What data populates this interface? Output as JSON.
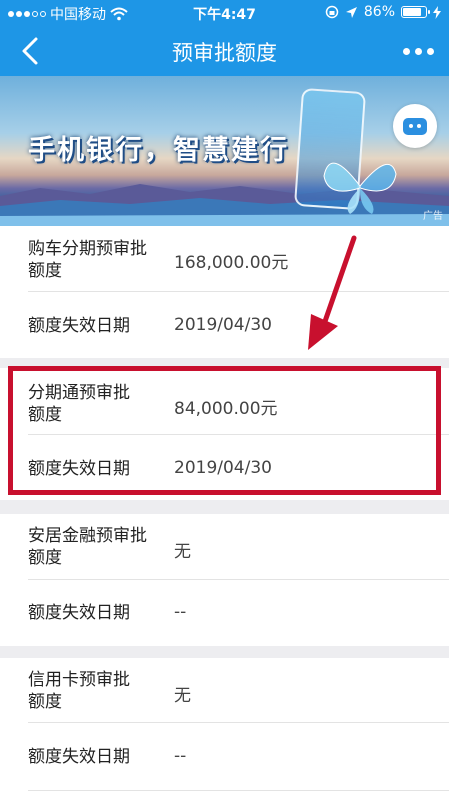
{
  "status_bar": {
    "carrier": "中国移动",
    "time": "下午4:47",
    "battery": "86%",
    "battery_level": 0.86
  },
  "nav": {
    "title": "预审批额度"
  },
  "banner": {
    "slogan": "手机银行，智慧建行",
    "ad_label": "广告"
  },
  "sections": [
    {
      "name_line1": "购车分期预审批",
      "name_line2": "额度",
      "amount": "168,000.00元",
      "date_label": "额度失效日期",
      "date": "2019/04/30"
    },
    {
      "name_line1": "分期通预审批",
      "name_line2": "额度",
      "amount": "84,000.00元",
      "date_label": "额度失效日期",
      "date": "2019/04/30"
    },
    {
      "name_line1": "安居金融预审批",
      "name_line2": "额度",
      "amount": "无",
      "date_label": "额度失效日期",
      "date": "--"
    },
    {
      "name_line1": "信用卡预审批",
      "name_line2": "额度",
      "amount": "无",
      "date_label": "额度失效日期",
      "date": "--"
    }
  ],
  "colors": {
    "brand_blue": "#1e96e6",
    "highlight_red": "#c8102e"
  }
}
